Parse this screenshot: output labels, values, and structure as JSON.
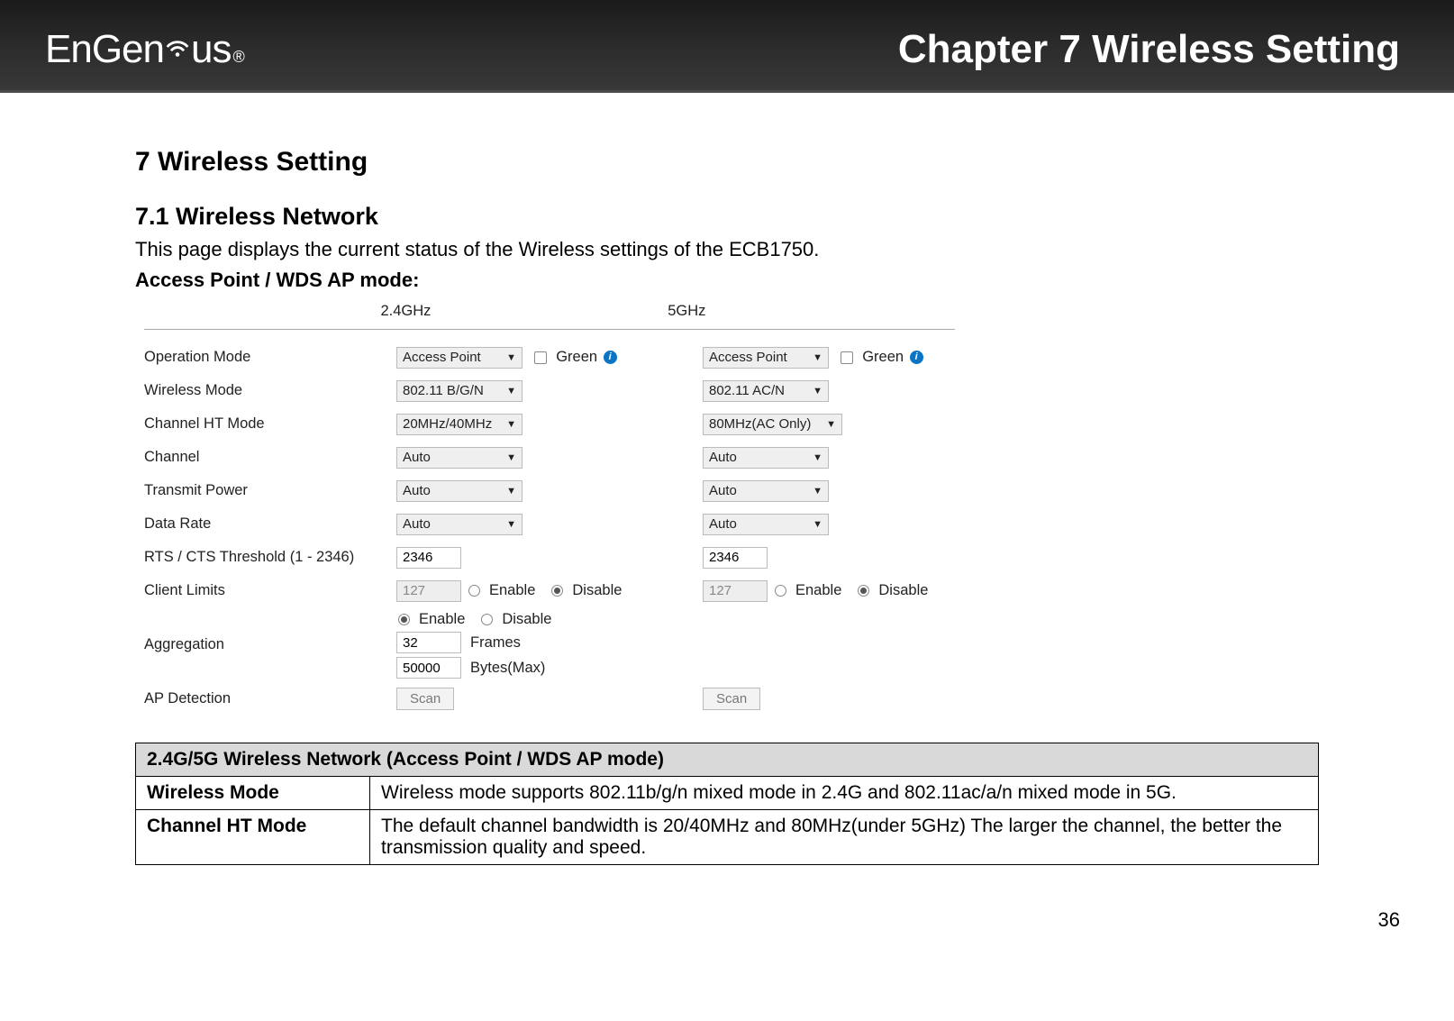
{
  "brand": {
    "name_a": "EnGen",
    "name_b": "us",
    "reg": "®"
  },
  "header": {
    "chapter": "Chapter 7  Wireless Setting"
  },
  "section": {
    "num_title": "7   Wireless Setting",
    "sub_num_title": "7.1   Wireless Network",
    "intro": "This page displays the current status of the Wireless settings of the ECB1750.",
    "mode_heading": "Access Point / WDS AP mode:"
  },
  "form": {
    "col24": "2.4GHz",
    "col5": "5GHz",
    "green": "Green",
    "enable": "Enable",
    "disable": "Disable",
    "rows": {
      "operation_mode": {
        "label": "Operation Mode",
        "v24": "Access Point",
        "v5": "Access Point"
      },
      "wireless_mode": {
        "label": "Wireless Mode",
        "v24": "802.11 B/G/N",
        "v5": "802.11 AC/N"
      },
      "channel_ht": {
        "label": "Channel HT Mode",
        "v24": "20MHz/40MHz",
        "v5": "80MHz(AC Only)"
      },
      "channel": {
        "label": "Channel",
        "v24": "Auto",
        "v5": "Auto"
      },
      "transmit_power": {
        "label": "Transmit Power",
        "v24": "Auto",
        "v5": "Auto"
      },
      "data_rate": {
        "label": "Data Rate",
        "v24": "Auto",
        "v5": "Auto"
      },
      "rts": {
        "label": "RTS / CTS Threshold (1 - 2346)",
        "v24": "2346",
        "v5": "2346"
      },
      "client_limits": {
        "label": "Client Limits",
        "v24": "127",
        "v5": "127"
      },
      "aggregation": {
        "label": "Aggregation",
        "frames_val": "32",
        "frames_lbl": "Frames",
        "bytes_val": "50000",
        "bytes_lbl": "Bytes(Max)"
      },
      "ap_detection": {
        "label": "AP Detection",
        "btn": "Scan"
      }
    }
  },
  "desc_table": {
    "header": "2.4G/5G Wireless Network (Access Point / WDS AP mode)",
    "rows": [
      {
        "k": "Wireless Mode",
        "v": "Wireless mode supports 802.11b/g/n mixed mode in 2.4G and 802.11ac/a/n mixed mode in 5G."
      },
      {
        "k": "Channel HT Mode",
        "v": "The default channel bandwidth is 20/40MHz and 80MHz(under 5GHz) The larger the channel, the better the transmission quality and speed."
      }
    ]
  },
  "page_number": "36"
}
